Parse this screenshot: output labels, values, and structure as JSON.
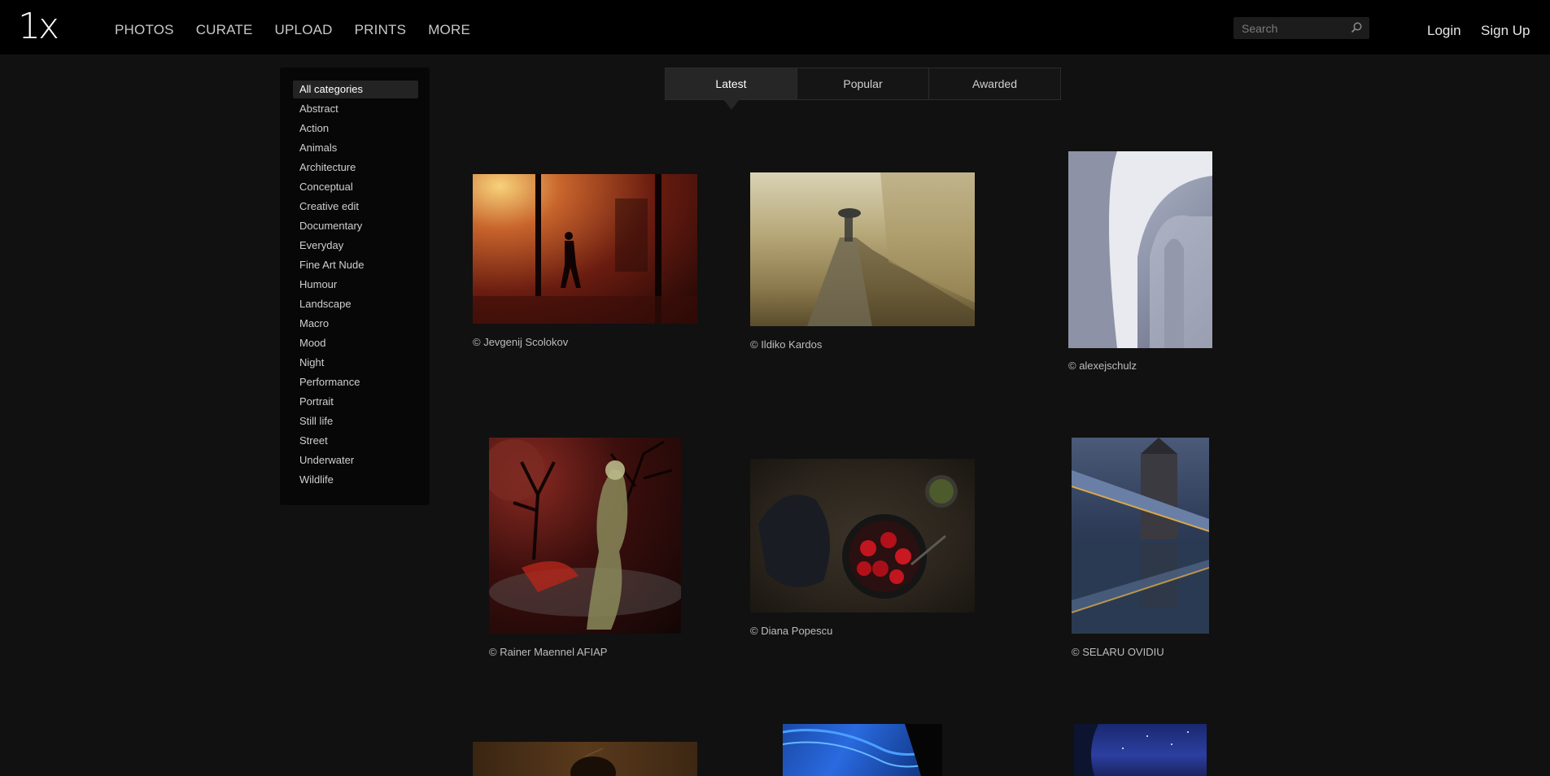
{
  "brand": {
    "logo": "1x"
  },
  "nav": [
    {
      "label": "PHOTOS"
    },
    {
      "label": "CURATE"
    },
    {
      "label": "UPLOAD"
    },
    {
      "label": "PRINTS"
    },
    {
      "label": "MORE"
    }
  ],
  "search": {
    "placeholder": "Search",
    "icon": "search-icon"
  },
  "auth": {
    "login": "Login",
    "signup": "Sign Up"
  },
  "sidebar": {
    "categories": [
      {
        "label": "All categories",
        "active": true
      },
      {
        "label": "Abstract"
      },
      {
        "label": "Action"
      },
      {
        "label": "Animals"
      },
      {
        "label": "Architecture"
      },
      {
        "label": "Conceptual"
      },
      {
        "label": "Creative edit"
      },
      {
        "label": "Documentary"
      },
      {
        "label": "Everyday"
      },
      {
        "label": "Fine Art Nude"
      },
      {
        "label": "Humour"
      },
      {
        "label": "Landscape"
      },
      {
        "label": "Macro"
      },
      {
        "label": "Mood"
      },
      {
        "label": "Night"
      },
      {
        "label": "Performance"
      },
      {
        "label": "Portrait"
      },
      {
        "label": "Still life"
      },
      {
        "label": "Street"
      },
      {
        "label": "Underwater"
      },
      {
        "label": "Wildlife"
      }
    ]
  },
  "tabs": [
    {
      "label": "Latest",
      "active": true
    },
    {
      "label": "Popular"
    },
    {
      "label": "Awarded"
    }
  ],
  "photos": [
    {
      "credit": "© Jevgenij Scolokov"
    },
    {
      "credit": "© Ildiko Kardos"
    },
    {
      "credit": "© alexejschulz"
    },
    {
      "credit": "© Rainer Maennel AFIAP"
    },
    {
      "credit": "© Diana Popescu"
    },
    {
      "credit": "© SELARU OVIDIU"
    }
  ],
  "colors": {
    "background": "#111111",
    "topbar": "#000000",
    "sidebar": "#070707"
  }
}
